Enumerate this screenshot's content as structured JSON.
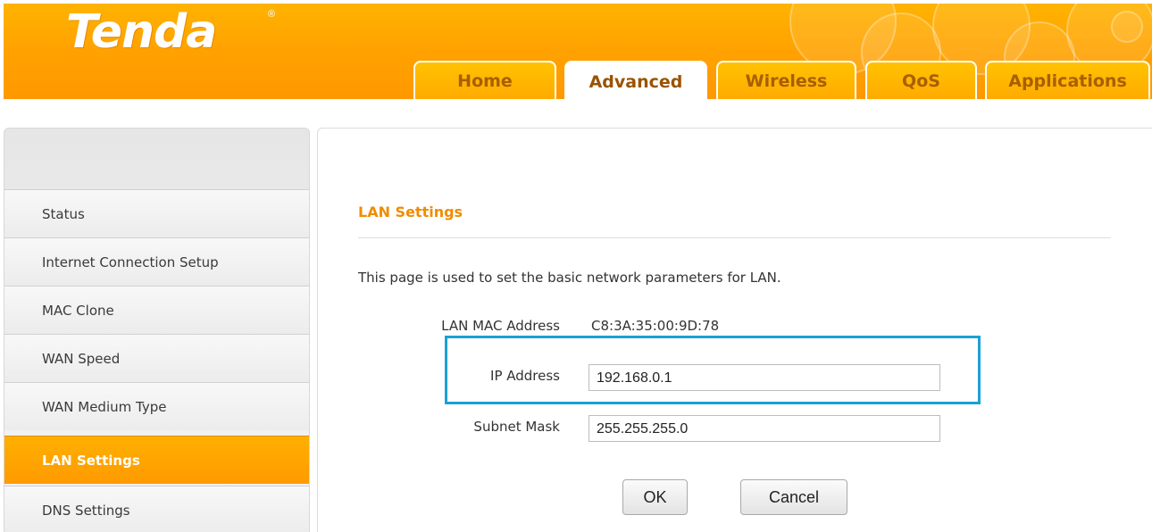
{
  "brand": {
    "logo_text": "Tenda",
    "registered_mark": "®"
  },
  "nav": {
    "tabs": [
      {
        "label": "Home",
        "active": false
      },
      {
        "label": "Advanced",
        "active": true
      },
      {
        "label": "Wireless",
        "active": false
      },
      {
        "label": "QoS",
        "active": false
      },
      {
        "label": "Applications",
        "active": false
      }
    ]
  },
  "sidebar": {
    "items": [
      {
        "label": "Status",
        "active": false
      },
      {
        "label": "Internet Connection Setup",
        "active": false
      },
      {
        "label": "MAC Clone",
        "active": false
      },
      {
        "label": "WAN Speed",
        "active": false
      },
      {
        "label": "WAN Medium Type",
        "active": false
      },
      {
        "label": "LAN Settings",
        "active": true
      },
      {
        "label": "DNS Settings",
        "active": false
      }
    ]
  },
  "main": {
    "title": "LAN Settings",
    "description": "This page is used to set the basic network parameters for LAN.",
    "mac_label": "LAN MAC Address",
    "mac_value": "C8:3A:35:00:9D:78",
    "ip_label": "IP Address",
    "ip_value": "192.168.0.1",
    "subnet_label": "Subnet Mask",
    "subnet_value": "255.255.255.0",
    "ok_label": "OK",
    "cancel_label": "Cancel"
  },
  "colors": {
    "header_orange": "#ffa300",
    "title_orange": "#f08c00",
    "highlight_blue": "#1aa1d6",
    "active_sidebar": "#ff9a00"
  }
}
